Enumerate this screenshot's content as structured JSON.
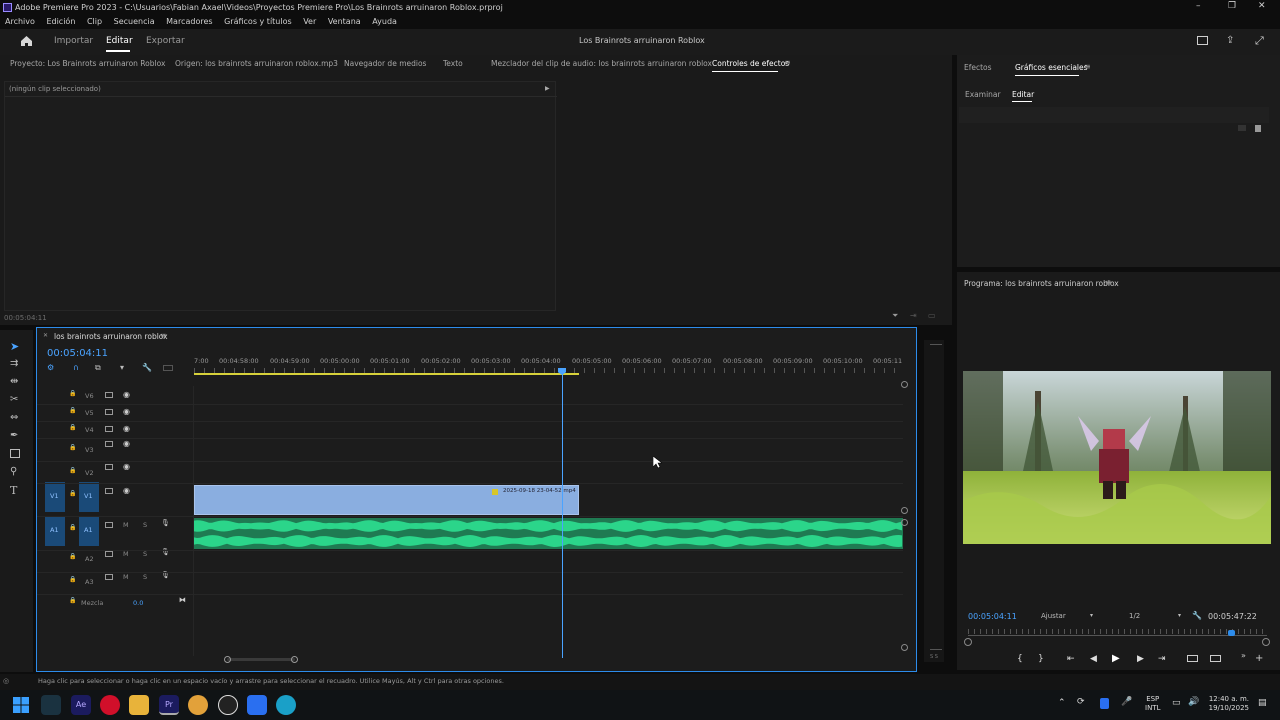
{
  "window": {
    "title": "Adobe Premiere Pro 2023 - C:\\Usuarios\\Fabian Axael\\Videos\\Proyectos Premiere Pro\\Los Brainrots arruinaron Roblox.prproj",
    "controls": [
      "–",
      "❐",
      "✕"
    ]
  },
  "menu": [
    "Archivo",
    "Edición",
    "Clip",
    "Secuencia",
    "Marcadores",
    "Gráficos y títulos",
    "Ver",
    "Ventana",
    "Ayuda"
  ],
  "header": {
    "home_icon": "home-icon",
    "tabs": [
      "Importar",
      "Editar",
      "Exportar"
    ],
    "active_tab": "Editar",
    "project_title": "Los Brainrots arruinaron Roblox"
  },
  "source_panel": {
    "tabs": [
      "Proyecto: Los Brainrots arruinaron Roblox",
      "Origen: los brainrots arruinaron roblox.mp3",
      "Navegador de medios",
      "Texto",
      "Mezclador del clip de audio: los brainrots arruinaron roblox",
      "Controles de efectos"
    ],
    "active_tab": "Controles de efectos",
    "no_clip": "(ningún clip seleccionado)",
    "timecode": "00:05:04:11"
  },
  "right_panel": {
    "tabs": [
      "Efectos",
      "Gráficos esenciales"
    ],
    "active_tab": "Gráficos esenciales",
    "subtabs": [
      "Examinar",
      "Editar"
    ],
    "active_subtab": "Editar"
  },
  "program": {
    "title": "Programa: los brainrots arruinaron roblox",
    "timecode": "00:05:04:11",
    "fit": "Ajustar",
    "quality": "1/2",
    "duration": "00:05:47:22",
    "playhead_fraction": 0.88
  },
  "timeline": {
    "sequence": "los brainrots arruinaron roblox",
    "timecode": "00:05:04:11",
    "ruler": [
      "7:00",
      "00:04:58:00",
      "00:04:59:00",
      "00:05:00:00",
      "00:05:01:00",
      "00:05:02:00",
      "00:05:03:00",
      "00:05:04:00",
      "00:05:05:00",
      "00:05:06:00",
      "00:05:07:00",
      "00:05:08:00",
      "00:05:09:00",
      "00:05:10:00",
      "00:05:11"
    ],
    "video_tracks": [
      "V6",
      "V5",
      "V4",
      "V3",
      "V2",
      "V1"
    ],
    "audio_tracks": [
      "A1",
      "A2",
      "A3"
    ],
    "source_v": "V1",
    "source_a": "A1",
    "video_clip": "2025-09-18 23-04-52.mp4",
    "mix_label": "Mezcla",
    "mix_value": "0.0",
    "audio_buttons": [
      "M",
      "S"
    ]
  },
  "status": "Haga clic para seleccionar o haga clic en un espacio vacío y arrastre para seleccionar el recuadro. Utilice Mayús, Alt y Ctrl para otras opciones.",
  "tools": [
    "selection-tool",
    "track-select-tool",
    "ripple-edit-tool",
    "razor-tool",
    "slip-tool",
    "pen-tool",
    "rectangle-tool",
    "hand-tool",
    "type-tool"
  ],
  "taskbar": {
    "lang": "ESP",
    "lang2": "INTL",
    "time": "12:40 a. m.",
    "date": "19/10/2025"
  },
  "colors": {
    "accent": "#2d8ceb",
    "video_clip": "#8aaee0",
    "audio_clip": "#2bd58a",
    "work_area": "#d7d13a"
  }
}
